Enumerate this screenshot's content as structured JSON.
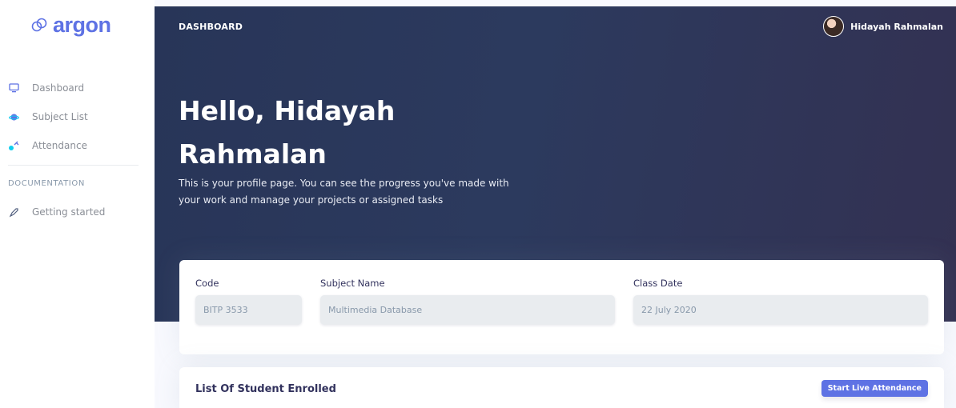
{
  "app": {
    "brand": "argon",
    "brand_color": "#5e72e4"
  },
  "sidebar": {
    "items": [
      {
        "label": "Dashboard",
        "icon": "monitor-icon",
        "icon_color": "#5e72e4"
      },
      {
        "label": "Subject List",
        "icon": "planet-icon",
        "icon_color": "#5e72e4"
      },
      {
        "label": "Attendance",
        "icon": "satellite-icon",
        "icon_color": "#11cdef"
      }
    ],
    "doc_heading": "DOCUMENTATION",
    "doc_items": [
      {
        "label": "Getting started",
        "icon": "spaceship-icon"
      }
    ]
  },
  "header": {
    "title": "DASHBOARD",
    "user_name": "Hidayah Rahmalan"
  },
  "hero": {
    "greeting": "Hello, Hidayah Rahmalan",
    "description": "This is your profile page. You can see the progress you've made with your work and manage your projects or assigned tasks"
  },
  "subject_form": {
    "code_label": "Code",
    "code_value": "BITP 3533",
    "name_label": "Subject Name",
    "name_value": "Multimedia Database",
    "date_label": "Class Date",
    "date_value": "22 July 2020"
  },
  "students": {
    "title": "List Of Student Enrolled",
    "live_button": "Start Live Attendance"
  }
}
